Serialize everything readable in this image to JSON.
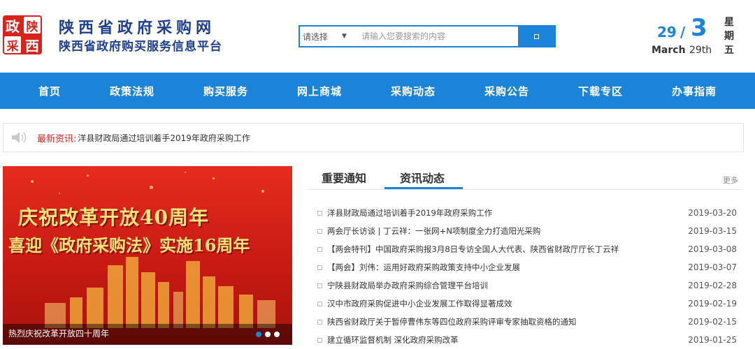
{
  "header": {
    "logo_chars": [
      "政",
      "陕",
      "采",
      "西"
    ],
    "title": "陕西省政府采购网",
    "subtitle": "陕西省政府购买服务信息平台"
  },
  "search": {
    "select_label": "请选择",
    "placeholder": "请输入您要搜索的内容"
  },
  "date": {
    "day": "29",
    "slash": "/",
    "month_num": "3",
    "month_name": "March",
    "ordinal": "29th",
    "weekday": "星期五"
  },
  "nav": {
    "items": [
      "首页",
      "政策法规",
      "购买服务",
      "网上商城",
      "采购动态",
      "采购公告",
      "下载专区",
      "办事指南"
    ]
  },
  "ticker": {
    "label": "最新资讯:",
    "text": "洋县财政局通过培训着手2019年政府采购工作"
  },
  "banner": {
    "line1": "庆祝改革开放40周年",
    "line2": "喜迎《政府采购法》实施16周年",
    "caption": "热烈庆祝改革开放四十周年"
  },
  "panel": {
    "tabs": [
      "重要通知",
      "资讯动态"
    ],
    "more": "更多",
    "news": [
      {
        "title": "洋县财政局通过培训着手2019年政府采购工作",
        "date": "2019-03-20"
      },
      {
        "title": "两会厅长访谈 | 丁云祥：一张网+N项制度全力打造阳光采购",
        "date": "2019-03-15"
      },
      {
        "title": "【两会特刊】中国政府采购报3月8日专访全国人大代表、陕西省财政厅厅长丁云祥",
        "date": "2019-03-08"
      },
      {
        "title": "【两会】刘伟：运用好政府采购政策支持中小企业发展",
        "date": "2019-03-07"
      },
      {
        "title": "宁陕县财政局举办政府采购综合管理平台培训",
        "date": "2019-02-28"
      },
      {
        "title": "汉中市政府采购促进中小企业发展工作取得显著成效",
        "date": "2019-02-19"
      },
      {
        "title": "陕西省财政厅关于暂停曹伟东等四位政府采购评审专家抽取资格的通知",
        "date": "2019-02-15"
      },
      {
        "title": "建立循环监督机制 深化政府采购改革",
        "date": "2019-01-25"
      }
    ]
  },
  "colors": {
    "brand_blue": "#1b83d8",
    "logo_red": "#d8231d",
    "title_navy": "#1f3f8f"
  },
  "icons": {
    "ticker": "speaker-icon",
    "search": "search-icon"
  }
}
